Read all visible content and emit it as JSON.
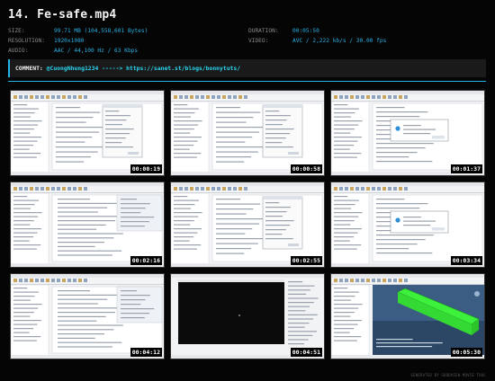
{
  "file": {
    "title": "14. Fe-safe.mp4"
  },
  "info": {
    "size_label": "SIZE:",
    "size_value": "99.71 MB (104,558,601 Bytes)",
    "resolution_label": "RESOLUTION:",
    "resolution_value": "1920x1080",
    "audio_label": "AUDIO:",
    "audio_value": "AAC / 44,100 Hz / 63 Kbps",
    "duration_label": "DURATION:",
    "duration_value": "00:05:50",
    "video_label": "VIDEO:",
    "video_value": "AVC / 2,222 kb/s / 30.00 fps"
  },
  "comment": {
    "label": "COMMENT:",
    "text": "@CuongNhung1234 -----> https://sanet.st/blogs/bonnytuts/"
  },
  "thumbnails": [
    {
      "timestamp": "00:00:19",
      "kind": "dialog"
    },
    {
      "timestamp": "00:00:58",
      "kind": "dialog"
    },
    {
      "timestamp": "00:01:37",
      "kind": "popup"
    },
    {
      "timestamp": "00:02:16",
      "kind": "tree"
    },
    {
      "timestamp": "00:02:55",
      "kind": "dialog"
    },
    {
      "timestamp": "00:03:34",
      "kind": "popup"
    },
    {
      "timestamp": "00:04:12",
      "kind": "tree"
    },
    {
      "timestamp": "00:04:51",
      "kind": "terminal"
    },
    {
      "timestamp": "00:05:30",
      "kind": "model"
    }
  ],
  "footer": {
    "text": "GENERATED BY GOODVIEW MOVIE TOOL"
  },
  "colors": {
    "accent": "#26b4e8",
    "value_text": "#2bb0e6",
    "model_green": "#3cf03c"
  }
}
